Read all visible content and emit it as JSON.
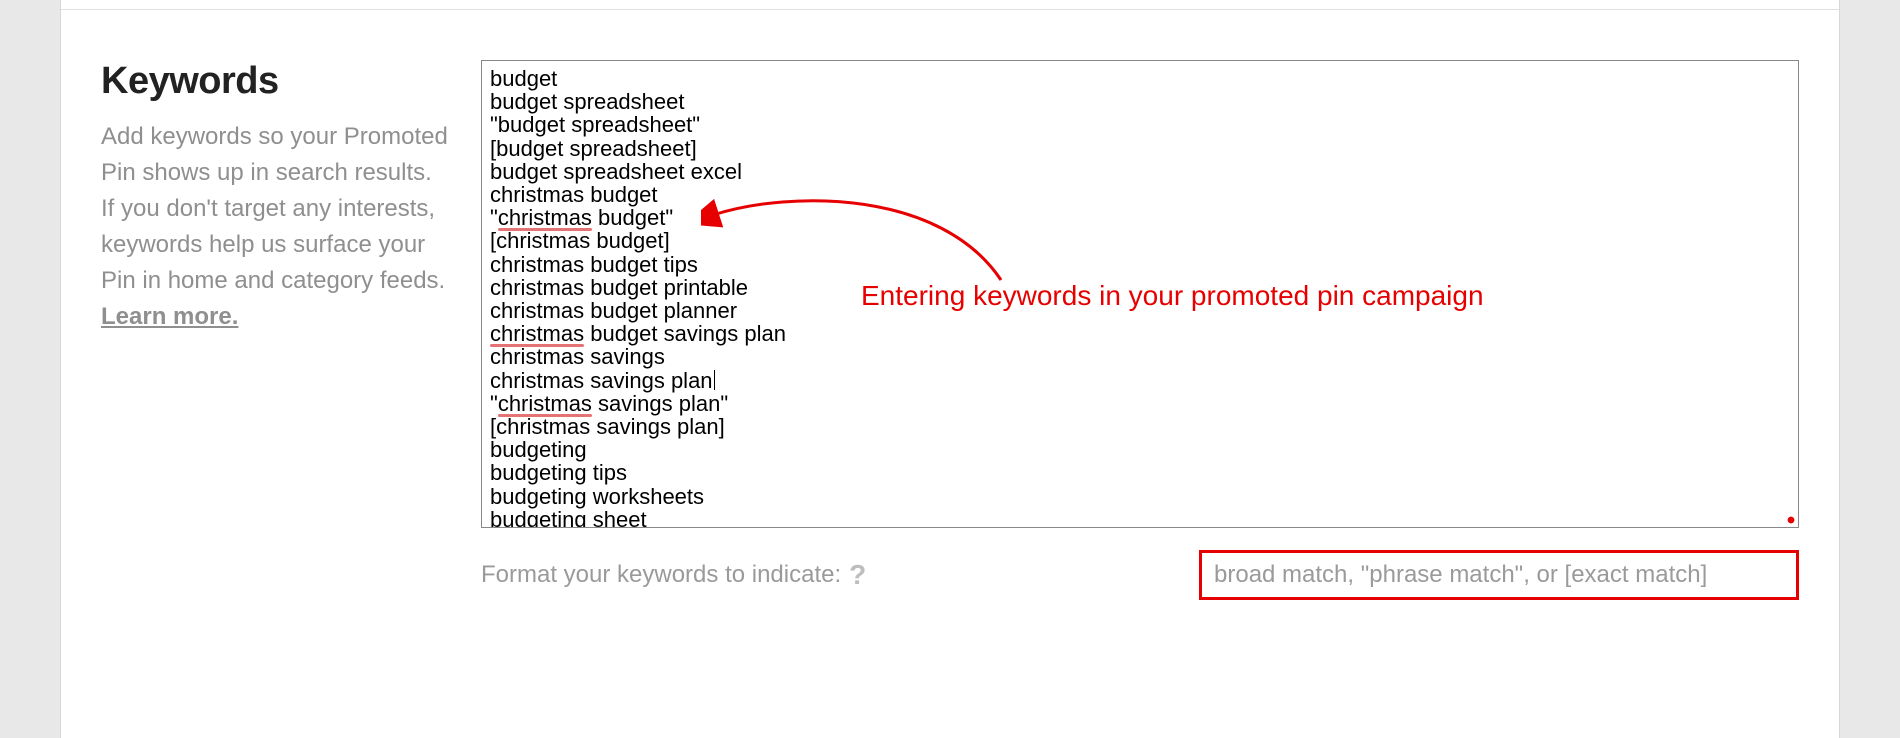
{
  "section": {
    "title": "Keywords",
    "description_prefix": "Add keywords so your Promoted Pin shows up in search results. If you don't target any interests, keywords help us surface your Pin in home and category feeds. ",
    "learn_more": "Learn more."
  },
  "keywords_textarea": {
    "lines": [
      {
        "text": "budget"
      },
      {
        "text": "budget spreadsheet"
      },
      {
        "text": "\"budget spreadsheet\""
      },
      {
        "text": "[budget spreadsheet]"
      },
      {
        "text": "budget spreadsheet excel"
      },
      {
        "text": "christmas budget"
      },
      {
        "prefix": "\"",
        "typo": "christmas",
        "suffix": " budget\""
      },
      {
        "text": "[christmas budget]"
      },
      {
        "text": "christmas budget tips"
      },
      {
        "text": "christmas budget printable"
      },
      {
        "text": "christmas budget planner"
      },
      {
        "typo": "christmas",
        "suffix": " budget savings plan"
      },
      {
        "text": "christmas savings"
      },
      {
        "text": "christmas savings plan",
        "cursor": true
      },
      {
        "prefix": "\"",
        "typo": "christmas",
        "suffix": " savings plan\""
      },
      {
        "text": "[christmas savings plan]"
      },
      {
        "text": "budgeting"
      },
      {
        "text": "budgeting tips"
      },
      {
        "text": "budgeting worksheets"
      },
      {
        "text": "budgeting sheet"
      }
    ]
  },
  "hint": {
    "label": "Format your keywords to indicate:",
    "help_glyph": "?",
    "matches": "broad match, \"phrase match\", or [exact match]"
  },
  "annotation": {
    "text": "Entering keywords in your promoted pin campaign"
  }
}
